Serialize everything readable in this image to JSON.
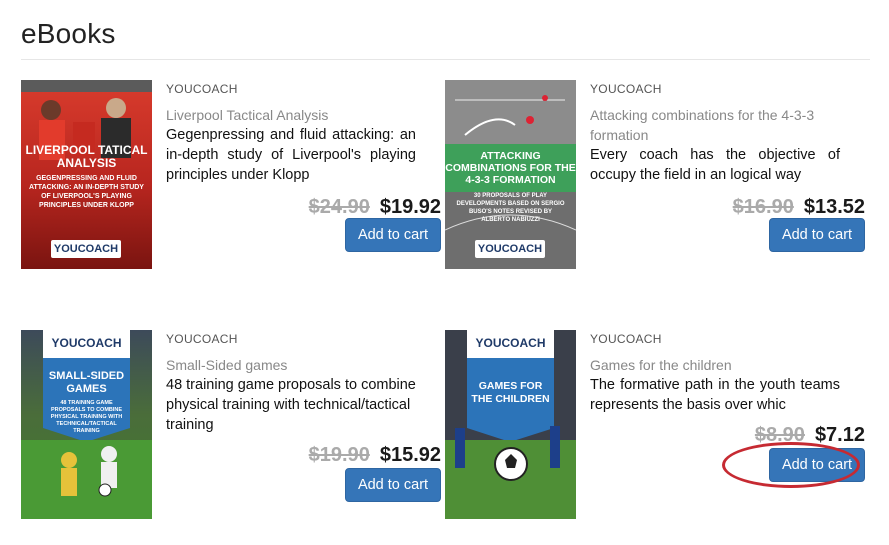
{
  "page": {
    "title": "eBooks"
  },
  "colors": {
    "accent": "#3575b8",
    "highlight": "#c62a32",
    "old_price": "#aaaaaa"
  },
  "books": [
    {
      "publisher": "YOUCOACH",
      "title": "Liverpool Tactical Analysis",
      "description": "Gegenpressing and fluid attacking: an in-depth study of Liverpool's playing principles under Klopp",
      "old_price": "$24.90",
      "price": "$19.92",
      "button": "Add to cart",
      "cover": {
        "heading": "LIVERPOOL TATICAL ANALYSIS",
        "subheading": "GEGENPRESSING AND FLUID ATTACKING: AN IN-DEPTH STUDY OF LIVERPOOL'S PLAYING PRINCIPLES UNDER KLOPP",
        "brand": "YOUCOACH"
      }
    },
    {
      "publisher": "YOUCOACH",
      "title": "Attacking combinations for the 4-3-3 formation",
      "description": "Every coach has the objective of occupy the field in an logical way",
      "old_price": "$16.90",
      "price": "$13.52",
      "button": "Add to cart",
      "cover": {
        "heading": "ATTACKING COMBINATIONS FOR THE 4-3-3 FORMATION",
        "subheading": "30 PROPOSALS OF PLAY DEVELOPMENTS BASED ON SERGIO BUSO'S NOTES REVISED BY ALBERTO NABIUZZI",
        "brand": "YOUCOACH"
      }
    },
    {
      "publisher": "YOUCOACH",
      "title": "Small-Sided games",
      "description": "48 training game proposals to combine physical training with technical/tactical training",
      "old_price": "$19.90",
      "price": "$15.92",
      "button": "Add to cart",
      "cover": {
        "heading": "SMALL-SIDED GAMES",
        "subheading": "48 TRAINING GAME PROPOSALS TO COMBINE PHYSICAL TRAINING WITH TECHNICAL/TACTICAL TRAINING",
        "brand": "YOUCOACH"
      }
    },
    {
      "publisher": "YOUCOACH",
      "title": "Games for the children",
      "description": "The formative path in the youth teams represents the basis over whic",
      "old_price": "$8.90",
      "price": "$7.12",
      "button": "Add to cart",
      "cover": {
        "heading": "GAMES FOR THE CHILDREN",
        "subheading": "",
        "brand": "YOUCOACH"
      }
    }
  ]
}
